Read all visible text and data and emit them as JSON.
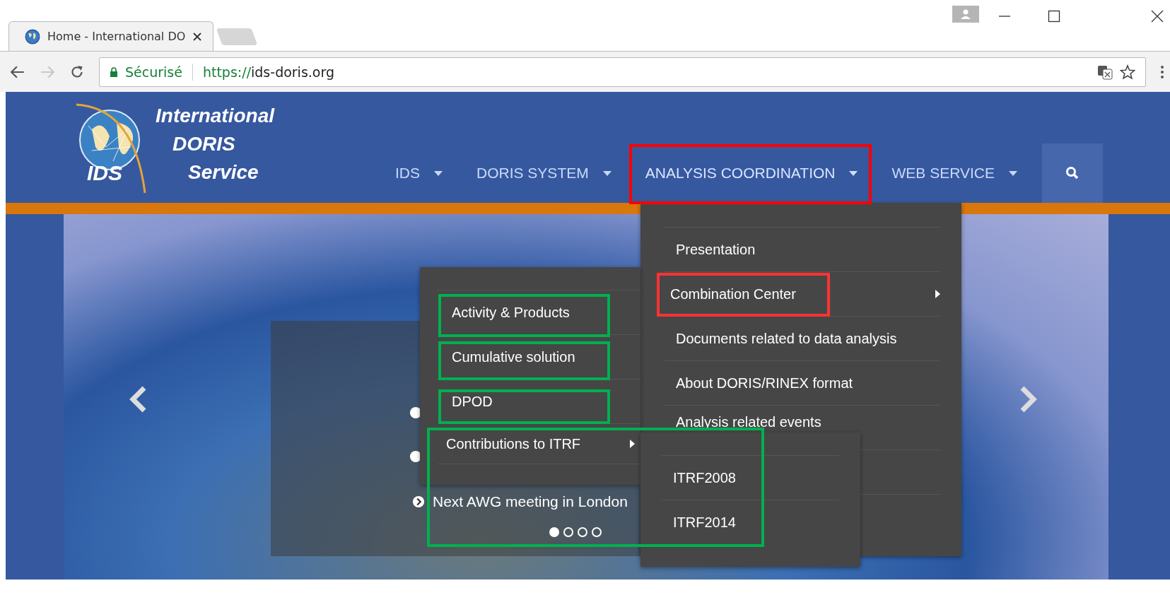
{
  "browser": {
    "tab": {
      "title": "Home - International DO",
      "selected": true
    },
    "security_label": "Sécurisé",
    "url": {
      "scheme": "https://",
      "host": "ids-doris.org"
    }
  },
  "site": {
    "logo": {
      "line_1": "International",
      "line_2": "DORIS",
      "line_3": "Service",
      "acronym": "IDS"
    },
    "nav": [
      {
        "label": "IDS",
        "selected": false
      },
      {
        "label": "DORIS SYSTEM",
        "selected": false
      },
      {
        "label": "ANALYSIS COORDINATION",
        "selected": true
      },
      {
        "label": "WEB SERVICE",
        "selected": false
      }
    ]
  },
  "dropdown": {
    "items": [
      {
        "label": "Presentation",
        "has_submenu": false
      },
      {
        "label": "Combination Center",
        "has_submenu": true
      },
      {
        "label": "Documents related to data analysis",
        "has_submenu": false
      },
      {
        "label": "About DORIS/RINEX format",
        "has_submenu": false
      },
      {
        "label": "Analysis related events",
        "has_submenu": false
      }
    ]
  },
  "submenu": {
    "items": [
      {
        "label": "Activity & Products",
        "has_submenu": false
      },
      {
        "label": "Cumulative solution",
        "has_submenu": false
      },
      {
        "label": "DPOD",
        "has_submenu": false
      },
      {
        "label": "Contributions to ITRF",
        "has_submenu": true
      }
    ]
  },
  "submenu_itrf": {
    "items": [
      {
        "label": "ITRF2008"
      },
      {
        "label": "ITRF2014"
      }
    ]
  },
  "slider": {
    "caption": "Next AWG meeting in London",
    "dots": [
      {
        "selected": true
      },
      {
        "selected": false
      },
      {
        "selected": false
      },
      {
        "selected": false
      }
    ]
  },
  "annotations": [
    {
      "color": "#ff0000"
    },
    {
      "color": "#ff3333"
    },
    {
      "color": "#00b04f"
    },
    {
      "color": "#00b04f"
    },
    {
      "color": "#00b04f"
    },
    {
      "color": "#00b04f"
    }
  ]
}
